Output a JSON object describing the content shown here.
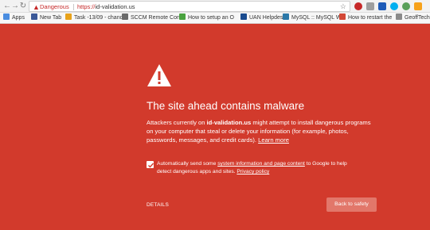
{
  "toolbar": {
    "security_status": "Dangerous",
    "url_scheme": "https://",
    "url_host": "id-validation.us",
    "icons": [
      "back-arrow-icon",
      "forward-arrow-icon",
      "reload-icon",
      "warning-triangle-icon",
      "star-icon"
    ]
  },
  "extensions": [
    {
      "name": "extension-red-icon",
      "color": "#c62828"
    },
    {
      "name": "extension-grey-icon",
      "color": "#9e9e9e"
    },
    {
      "name": "extension-mail-icon",
      "color": "#1e5bb8"
    },
    {
      "name": "extension-skype-icon",
      "color": "#00aff0"
    },
    {
      "name": "extension-refresh-icon",
      "color": "#5aa05a"
    },
    {
      "name": "extension-star-icon",
      "color": "#f7a21b"
    }
  ],
  "bookmarks": [
    {
      "label": "Apps",
      "icon": "apps-grid-icon",
      "color": "#4a8de0"
    },
    {
      "label": "New Tab",
      "icon": "page-icon",
      "color": "#3b5998"
    },
    {
      "label": "Task -13/09 - chandr",
      "icon": "page-icon",
      "color": "#e8a21b"
    },
    {
      "label": "SCCM Remote Contr",
      "icon": "page-icon",
      "color": "#6b6b6b"
    },
    {
      "label": "How to setup an O",
      "icon": "page-icon",
      "color": "#4aa33f"
    },
    {
      "label": "UAN Helpdesk",
      "icon": "page-icon",
      "color": "#1a4b8f"
    },
    {
      "label": "MySQL :: MySQL Wo",
      "icon": "page-icon",
      "color": "#2b78a8"
    },
    {
      "label": "How to restart the",
      "icon": "page-icon",
      "color": "#d34836"
    },
    {
      "label": "GeoffTech.c",
      "icon": "page-icon",
      "color": "#8a8a8a"
    }
  ],
  "interstitial": {
    "icon": "warning-triangle-icon",
    "headline": "The site ahead contains malware",
    "desc_part1": "Attackers currently on ",
    "desc_site": "id-validation.us",
    "desc_part2": " might attempt to install dangerous programs on your computer that steal or delete your information (for example, photos, passwords, messages, and credit cards). ",
    "learn_more": "Learn more",
    "checkbox_checked": true,
    "report_part1": "Automatically send some ",
    "report_link": "system information and page content",
    "report_part2": " to Google to help detect dangerous apps and sites. ",
    "privacy_link": "Privacy policy",
    "details_label": "DETAILS",
    "back_button_label": "Back to safety",
    "background_color": "#d23a2c",
    "button_color": "#e2776a"
  }
}
